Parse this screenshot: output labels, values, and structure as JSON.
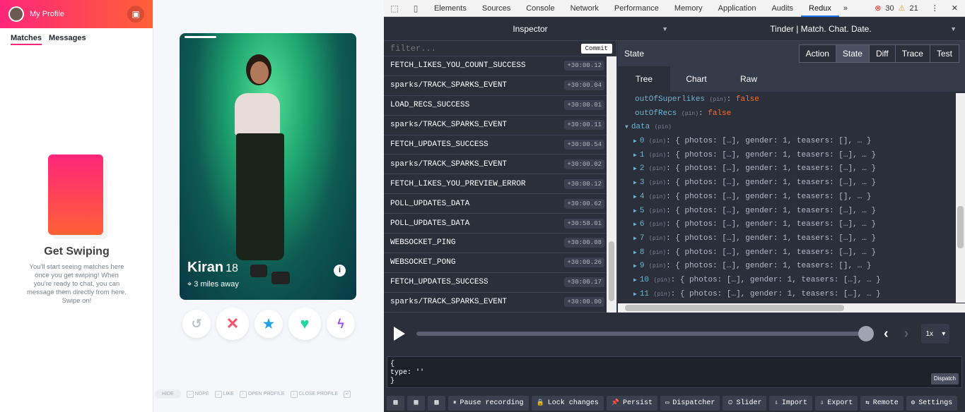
{
  "sidebar": {
    "title": "My Profile",
    "tabs": [
      "Matches",
      "Messages"
    ],
    "get_swiping_title": "Get Swiping",
    "get_swiping_text": "You'll start seeing matches here once you get swiping! When you're ready to chat, you can message them directly from here. Swipe on!"
  },
  "card": {
    "name": "Kiran",
    "age": "18",
    "distance": "3 miles away",
    "info": "i"
  },
  "actions": {
    "rewind": "↺",
    "nope": "✕",
    "superlike": "★",
    "like": "♥",
    "boost": "ϟ"
  },
  "shortcuts": {
    "hide": "HIDE",
    "nope": "NOPE",
    "like": "LIKE",
    "open_profile": "OPEN PROFILE",
    "close_profile": "CLOSE PROFILE"
  },
  "devtools": {
    "tabs": [
      "Elements",
      "Sources",
      "Console",
      "Network",
      "Performance",
      "Memory",
      "Application",
      "Audits",
      "Redux"
    ],
    "active_tab": "Redux",
    "more": "»",
    "errors": "30",
    "warnings": "21",
    "menu": "⋮",
    "close": "✕"
  },
  "redux": {
    "inspector_label": "Inspector",
    "instance_label": "Tinder | Match. Chat. Date.",
    "filter_placeholder": "filter...",
    "commit_label": "Commit",
    "actions": [
      {
        "name": "FETCH_LIKES_YOU_COUNT_SUCCESS",
        "time": "+30:00.12"
      },
      {
        "name": "sparks/TRACK_SPARKS_EVENT",
        "time": "+30:00.04"
      },
      {
        "name": "LOAD_RECS_SUCCESS",
        "time": "+30:00.01"
      },
      {
        "name": "sparks/TRACK_SPARKS_EVENT",
        "time": "+30:00.11"
      },
      {
        "name": "FETCH_UPDATES_SUCCESS",
        "time": "+30:00.54"
      },
      {
        "name": "sparks/TRACK_SPARKS_EVENT",
        "time": "+30:00.02"
      },
      {
        "name": "FETCH_LIKES_YOU_PREVIEW_ERROR",
        "time": "+30:00.12"
      },
      {
        "name": "POLL_UPDATES_DATA",
        "time": "+30:00.62"
      },
      {
        "name": "POLL_UPDATES_DATA",
        "time": "+30:58.01"
      },
      {
        "name": "WEBSOCKET_PING",
        "time": "+30:00.08"
      },
      {
        "name": "WEBSOCKET_PONG",
        "time": "+30:00.26"
      },
      {
        "name": "FETCH_UPDATES_SUCCESS",
        "time": "+30:00.17"
      },
      {
        "name": "sparks/TRACK_SPARKS_EVENT",
        "time": "+30:00.00"
      }
    ],
    "state_title": "State",
    "monitor_buttons": [
      "Action",
      "State",
      "Diff",
      "Trace",
      "Test"
    ],
    "active_monitor": "State",
    "subtabs": [
      "Tree",
      "Chart",
      "Raw"
    ],
    "active_subtab": "Tree",
    "pin": "(pin)",
    "tree_bool": [
      {
        "key": "outOfSuperlikes",
        "value": "false"
      },
      {
        "key": "outOfRecs",
        "value": "false"
      }
    ],
    "data_key": "data",
    "data_items": [
      {
        "idx": "0",
        "value": "{ photos: […], gender: 1, teasers: [], … }"
      },
      {
        "idx": "1",
        "value": "{ photos: […], gender: 1, teasers: […], … }"
      },
      {
        "idx": "2",
        "value": "{ photos: […], gender: 1, teasers: […], … }"
      },
      {
        "idx": "3",
        "value": "{ photos: […], gender: 1, teasers: […], … }"
      },
      {
        "idx": "4",
        "value": "{ photos: […], gender: 1, teasers: [], … }"
      },
      {
        "idx": "5",
        "value": "{ photos: […], gender: 1, teasers: […], … }"
      },
      {
        "idx": "6",
        "value": "{ photos: […], gender: 1, teasers: […], … }"
      },
      {
        "idx": "7",
        "value": "{ photos: […], gender: 1, teasers: […], … }"
      },
      {
        "idx": "8",
        "value": "{ photos: […], gender: 1, teasers: […], … }"
      },
      {
        "idx": "9",
        "value": "{ photos: […], gender: 1, teasers: [], … }"
      },
      {
        "idx": "10",
        "value": "{ photos: […], gender: 1, teasers: […], … }"
      },
      {
        "idx": "11",
        "value": "{ photos: […], gender: 1, teasers: […], … }"
      }
    ],
    "speed": "1x",
    "dispatch_text": "{\ntype: ''\n}",
    "dispatch_label": "Dispatch",
    "bottom_buttons": [
      {
        "icon": "pause-icon",
        "label": "Pause recording"
      },
      {
        "icon": "lock-icon",
        "label": "Lock changes"
      },
      {
        "icon": "pin-icon",
        "label": "Persist"
      },
      {
        "icon": "dispatcher-icon",
        "label": "Dispatcher"
      },
      {
        "icon": "slider-icon",
        "label": "Slider"
      },
      {
        "icon": "import-icon",
        "label": "Import"
      },
      {
        "icon": "export-icon",
        "label": "Export"
      },
      {
        "icon": "remote-icon",
        "label": "Remote"
      },
      {
        "icon": "gear-icon",
        "label": "Settings"
      }
    ]
  },
  "colors": {
    "tinder_pink": "#fd267a",
    "tinder_orange": "#ff6036",
    "redux_bg": "#2a2f3a",
    "false_value": "#fc6d24",
    "tree_key": "#6fb3d2"
  }
}
